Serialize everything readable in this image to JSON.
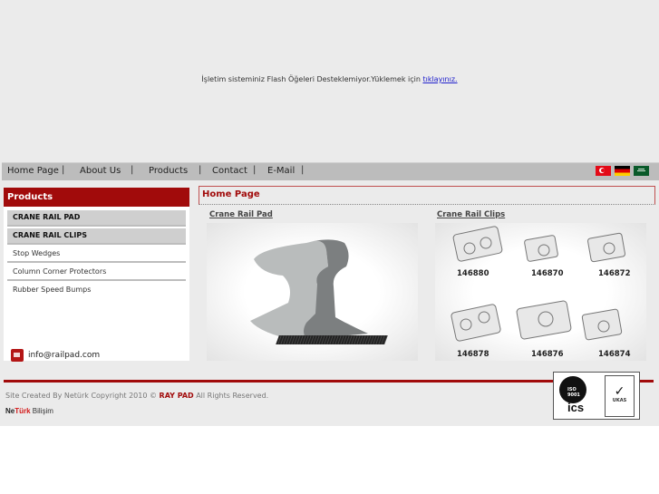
{
  "flash": {
    "message": "İşletim sisteminiz Flash Öğeleri Desteklemiyor.Yüklemek için ",
    "link": "tıklayınız."
  },
  "nav": {
    "items": [
      "Home Page",
      "About Us",
      "Products",
      "Contact",
      "E-Mail"
    ],
    "separator": "|",
    "languages": [
      "turkish-flag",
      "german-flag",
      "saudi-flag"
    ]
  },
  "sidebar": {
    "title": "Products",
    "items": [
      {
        "label": "CRANE RAIL PAD",
        "active": true
      },
      {
        "label": "CRANE RAIL CLIPS",
        "active": true
      },
      {
        "label": "Stop Wedges",
        "active": false
      },
      {
        "label": "Column Corner Protectors",
        "active": false
      },
      {
        "label": "Rubber Speed Bumps",
        "active": false
      }
    ],
    "email": "info@railpad.com"
  },
  "content": {
    "title": "Home Page",
    "products": [
      {
        "label": "Crane Rail Pad"
      },
      {
        "label": "Crane Rail Clips",
        "codes": [
          "146880",
          "146870",
          "146872",
          "146878",
          "146876",
          "146874"
        ]
      }
    ]
  },
  "footer": {
    "prefix": "Site Created By Netürk Copyright 2010 © ",
    "brand": "RAY PAD",
    "suffix": " All Rights Reserved.",
    "logo_ne": "Ne",
    "logo_turk": "Türk",
    "logo_bilisim": " Bilişim",
    "cert_iso": "ISO 9001",
    "cert_ics": "ics",
    "cert_ukas": "UKAS"
  },
  "colors": {
    "brand_red": "#a10b0b",
    "nav_bg": "#bcbcbc",
    "page_bg": "#ebebeb"
  }
}
